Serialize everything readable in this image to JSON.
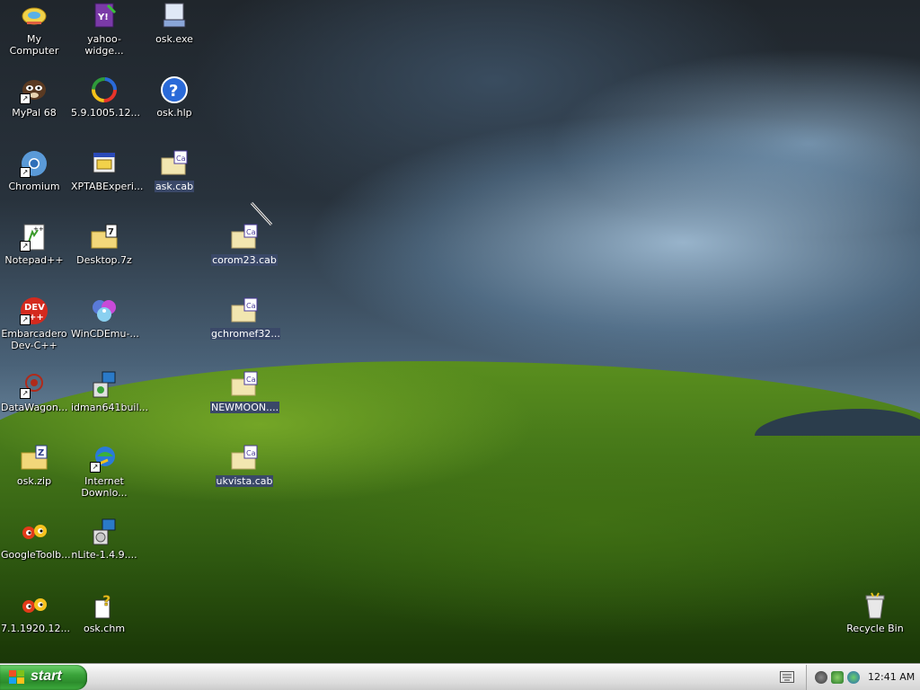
{
  "desktop": {
    "icons": [
      {
        "label": "My Computer",
        "icon": "my-computer-icon"
      },
      {
        "label": "yahoo-widge...",
        "icon": "yahoo-widgets-installer-icon"
      },
      {
        "label": "osk.exe",
        "icon": "keyboard-app-icon"
      },
      {
        "label": "MyPal 68",
        "icon": "mypal-browser-icon"
      },
      {
        "label": "5.9.1005.12...",
        "icon": "ring-app-icon"
      },
      {
        "label": "osk.hlp",
        "icon": "help-file-icon"
      },
      {
        "label": "Chromium",
        "icon": "chromium-icon"
      },
      {
        "label": "XPTABExperi...",
        "icon": "installer-icon"
      },
      {
        "label": "ask.cab",
        "icon": "cab-file-icon"
      },
      {
        "label": "Notepad++",
        "icon": "notepad-plus-plus-icon"
      },
      {
        "label": "Desktop.7z",
        "icon": "archive-7z-icon"
      },
      {
        "label": "corom23.cab",
        "icon": "cab-file-icon"
      },
      {
        "label": "Embarcadero Dev-C++",
        "icon": "dev-cpp-icon"
      },
      {
        "label": "WinCDEmu-...",
        "icon": "disc-icon"
      },
      {
        "label": "gchromef32...",
        "icon": "cab-file-icon"
      },
      {
        "label": "DataWagon...",
        "icon": "datawagon-icon"
      },
      {
        "label": "idman641buil...",
        "icon": "setup-package-icon"
      },
      {
        "label": "NEWMOON....",
        "icon": "cab-file-icon"
      },
      {
        "label": "osk.zip",
        "icon": "zip-folder-icon"
      },
      {
        "label": "Internet Downlo...",
        "icon": "internet-download-manager-icon"
      },
      {
        "label": "ukvista.cab",
        "icon": "cab-file-icon"
      },
      {
        "label": "GoogleToolb...",
        "icon": "google-toolbar-eyes-icon"
      },
      {
        "label": "nLite-1.4.9....",
        "icon": "setup-package-icon"
      },
      {
        "label": "7.1.1920.12...",
        "icon": "google-toolbar-eyes-icon"
      },
      {
        "label": "osk.chm",
        "icon": "chm-help-icon"
      },
      {
        "label": "Recycle Bin",
        "icon": "recycle-bin-icon"
      }
    ]
  },
  "taskbar": {
    "start_label": "start",
    "clock": "12:41 AM",
    "tray_icons": [
      "network-icon",
      "shield-icon",
      "globe-icon"
    ]
  },
  "colors": {
    "start_green": "#3aa33a",
    "selection": "#3a4868"
  }
}
